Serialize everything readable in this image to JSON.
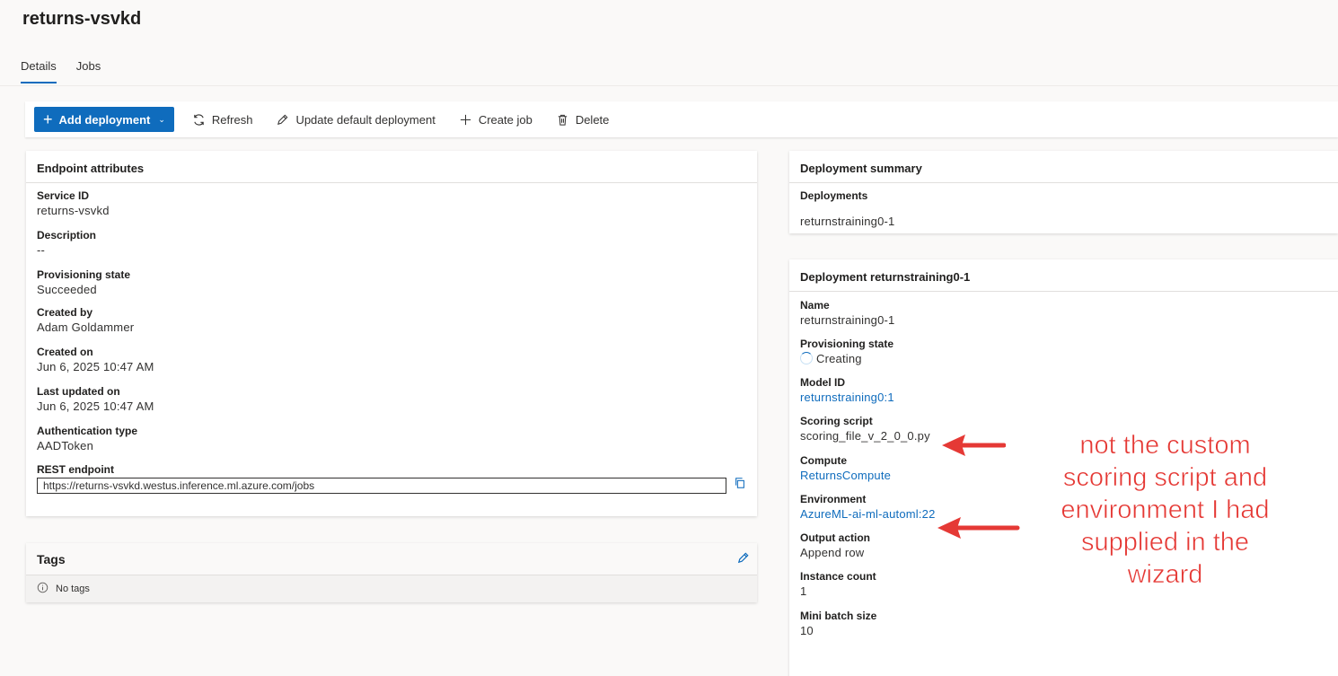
{
  "page": {
    "title": "returns-vsvkd"
  },
  "tabs": [
    {
      "label": "Details"
    },
    {
      "label": "Jobs"
    }
  ],
  "toolbar": {
    "add_deployment": "Add deployment",
    "refresh": "Refresh",
    "update_default": "Update default deployment",
    "create_job": "Create job",
    "delete": "Delete"
  },
  "endpoint": {
    "header": "Endpoint attributes",
    "fields": [
      {
        "label": "Service ID",
        "value": "returns-vsvkd"
      },
      {
        "label": "Description",
        "value": "--"
      },
      {
        "label": "Provisioning state",
        "value": "Succeeded"
      },
      {
        "label": "Created by",
        "value": "Adam Goldammer"
      },
      {
        "label": "Created on",
        "value": "Jun 6, 2025 10:47 AM"
      },
      {
        "label": "Last updated on",
        "value": "Jun 6, 2025 10:47 AM"
      },
      {
        "label": "Authentication type",
        "value": "AADToken"
      }
    ],
    "rest_label": "REST endpoint",
    "rest_value": "https://returns-vsvkd.westus.inference.ml.azure.com/jobs"
  },
  "tags": {
    "header": "Tags",
    "empty": "No tags"
  },
  "summary": {
    "header": "Deployment summary",
    "label": "Deployments",
    "value": "returnstraining0-1"
  },
  "deployment": {
    "header": "Deployment returnstraining0-1",
    "fields": [
      {
        "label": "Name",
        "value": "returnstraining0-1"
      },
      {
        "label": "Provisioning state",
        "value": "Creating"
      },
      {
        "label": "Model ID",
        "value": "returnstraining0:1"
      },
      {
        "label": "Scoring script",
        "value": "scoring_file_v_2_0_0.py"
      },
      {
        "label": "Compute",
        "value": "ReturnsCompute"
      },
      {
        "label": "Environment",
        "value": "AzureML-ai-ml-automl:22"
      },
      {
        "label": "Output action",
        "value": "Append row"
      },
      {
        "label": "Instance count",
        "value": "1"
      },
      {
        "label": "Mini batch size",
        "value": "10"
      }
    ]
  },
  "annotation": {
    "text_lines": [
      "not the custom",
      "scoring script and",
      "environment I had",
      "supplied in the",
      "wizard"
    ],
    "color": "#e53935"
  },
  "colors": {
    "accent": "#0f6cbd",
    "annotation": "#e53935"
  }
}
